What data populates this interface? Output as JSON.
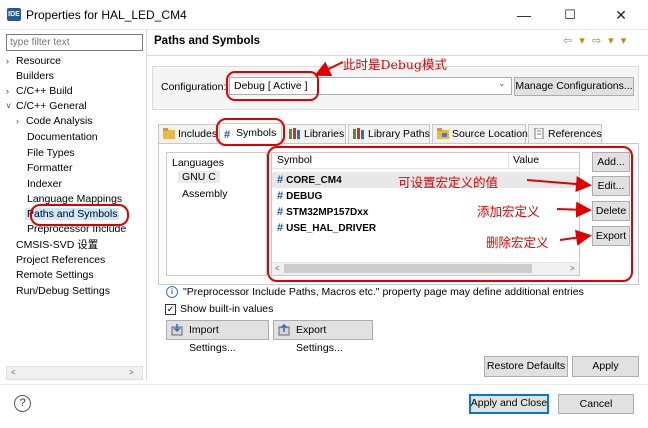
{
  "window": {
    "title": "Properties for HAL_LED_CM4",
    "app_icon": "IDE",
    "minimize": "—",
    "maximize": "☐",
    "close": "✕"
  },
  "sidebar": {
    "filter_placeholder": "type filter text",
    "items": [
      {
        "label": "Resource",
        "arrow": "›"
      },
      {
        "label": "Builders",
        "arrow": ""
      },
      {
        "label": "C/C++ Build",
        "arrow": "›"
      },
      {
        "label": "C/C++ General",
        "arrow": "˅"
      },
      {
        "label": "Code Analysis",
        "arrow": "›"
      },
      {
        "label": "Documentation",
        "arrow": ""
      },
      {
        "label": "File Types",
        "arrow": ""
      },
      {
        "label": "Formatter",
        "arrow": ""
      },
      {
        "label": "Indexer",
        "arrow": ""
      },
      {
        "label": "Language Mappings",
        "arrow": ""
      },
      {
        "label": "Paths and Symbols",
        "arrow": ""
      },
      {
        "label": "Preprocessor Include",
        "arrow": ""
      },
      {
        "label": "CMSIS-SVD 设置",
        "arrow": ""
      },
      {
        "label": "Project References",
        "arrow": ""
      },
      {
        "label": "Remote Settings",
        "arrow": ""
      },
      {
        "label": "Run/Debug Settings",
        "arrow": ""
      }
    ],
    "scroll_left": "<",
    "scroll_right": ">"
  },
  "page": {
    "title": "Paths and Symbols",
    "nav_arrows": "⇦ ▾ ⇨ ▾ ▾"
  },
  "configuration": {
    "label": "Configuration:",
    "value": "Debug  [ Active ]",
    "manage_button": "Manage Configurations..."
  },
  "tabs": [
    {
      "label": "Includes"
    },
    {
      "label": "Symbols"
    },
    {
      "label": "Libraries"
    },
    {
      "label": "Library Paths"
    },
    {
      "label": "Source Location"
    },
    {
      "label": "References"
    }
  ],
  "languages": {
    "header": "Languages",
    "items": [
      "GNU C",
      "Assembly"
    ]
  },
  "symbols_table": {
    "col_symbol": "Symbol",
    "col_value": "Value",
    "rows": [
      "CORE_CM4",
      "DEBUG",
      "STM32MP157Dxx",
      "USE_HAL_DRIVER"
    ]
  },
  "side_buttons": {
    "add": "Add...",
    "edit": "Edit...",
    "delete": "Delete",
    "export": "Export"
  },
  "info_text": "\"Preprocessor Include Paths, Macros etc.\" property page may define additional entries",
  "show_builtin": {
    "label": "Show built-in values",
    "checked": true
  },
  "import_button": "Import Settings...",
  "export_settings_button": "Export Settings...",
  "restore_defaults_button": "Restore Defaults",
  "apply_button": "Apply",
  "apply_close_button": "Apply and Close",
  "cancel_button": "Cancel",
  "annotations": {
    "debug_mode": "此时是Debug模式",
    "edit_value": "可设置宏定义的值",
    "add_macro": "添加宏定义",
    "delete_macro": "删除宏定义"
  },
  "colors": {
    "annotation_red": "#e00000",
    "selection_blue": "#cce8ff",
    "symbol_hash_blue": "#1f4fa8"
  }
}
